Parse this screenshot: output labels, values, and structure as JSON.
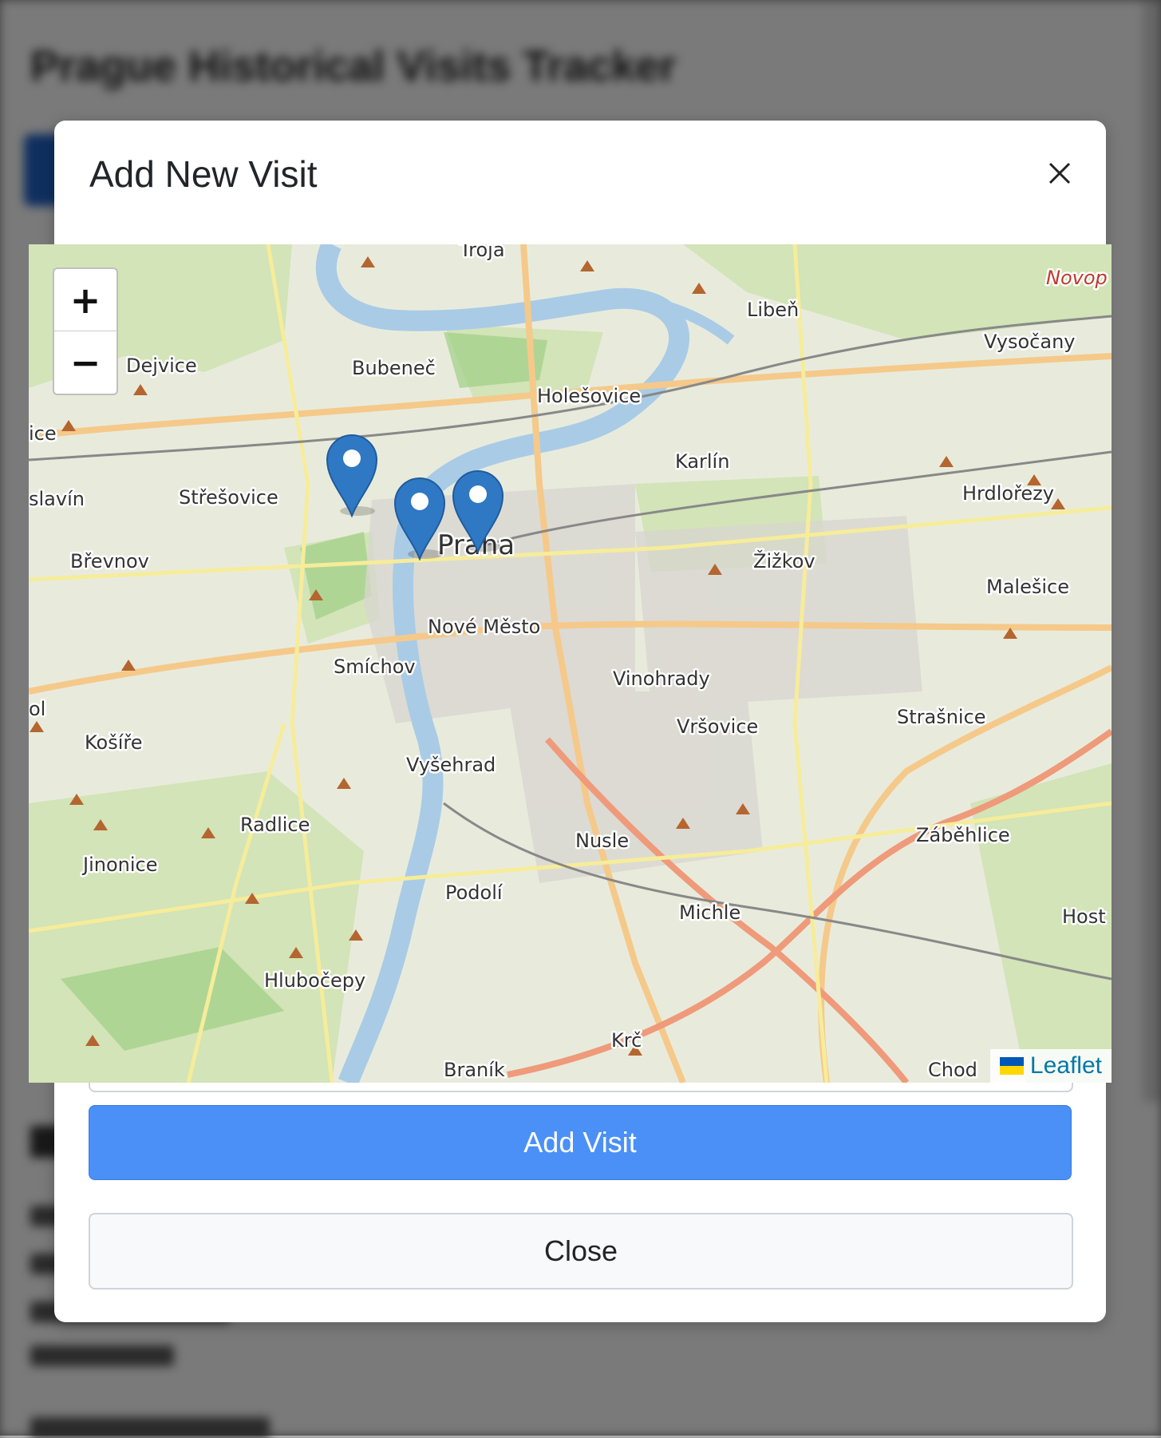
{
  "background": {
    "page_title": "Prague Historical Visits Tracker"
  },
  "modal": {
    "title": "Add New Visit",
    "close_icon": "close-icon",
    "add_button_label": "Add Visit",
    "close_button_label": "Close"
  },
  "map": {
    "zoom_in_label": "+",
    "zoom_out_label": "−",
    "attribution": "Leaflet",
    "marker_icon": "map-marker-icon",
    "marker_count": 3,
    "labels": {
      "troja": "Troja",
      "liben": "Libeň",
      "novop": "Novop",
      "vysocany": "Vysočany",
      "dejvice": "Dejvice",
      "bubenec": "Bubeneč",
      "holesovice": "Holešovice",
      "ice": "ice",
      "karlin": "Karlín",
      "hrdlorezy": "Hrdlořezy",
      "slavin": "slavín",
      "stresovice": "Střešovice",
      "praha": "Praha",
      "brevnov": "Břevnov",
      "zizkov": "Žižkov",
      "malesice": "Malešice",
      "nove_mesto": "Nové Město",
      "smichov": "Smíchov",
      "vinohrady": "Vinohrady",
      "ol": "ol",
      "strasnice": "Strašnice",
      "vrsovice": "Vršovice",
      "kosire": "Košíře",
      "vysehrad": "Vyšehrad",
      "radlice": "Radlice",
      "nusle": "Nusle",
      "zabehlice": "Záběhlice",
      "jinonice": "Jinonice",
      "podoli": "Podolí",
      "michle": "Michle",
      "host": "Host",
      "hlubocepy": "Hlubočepy",
      "krc": "Krč",
      "branik": "Braník",
      "chod": "Chod"
    }
  },
  "colors": {
    "primary_button": "#4a90f7",
    "marker": "#2f78c4",
    "river": "#a9cbe6"
  }
}
